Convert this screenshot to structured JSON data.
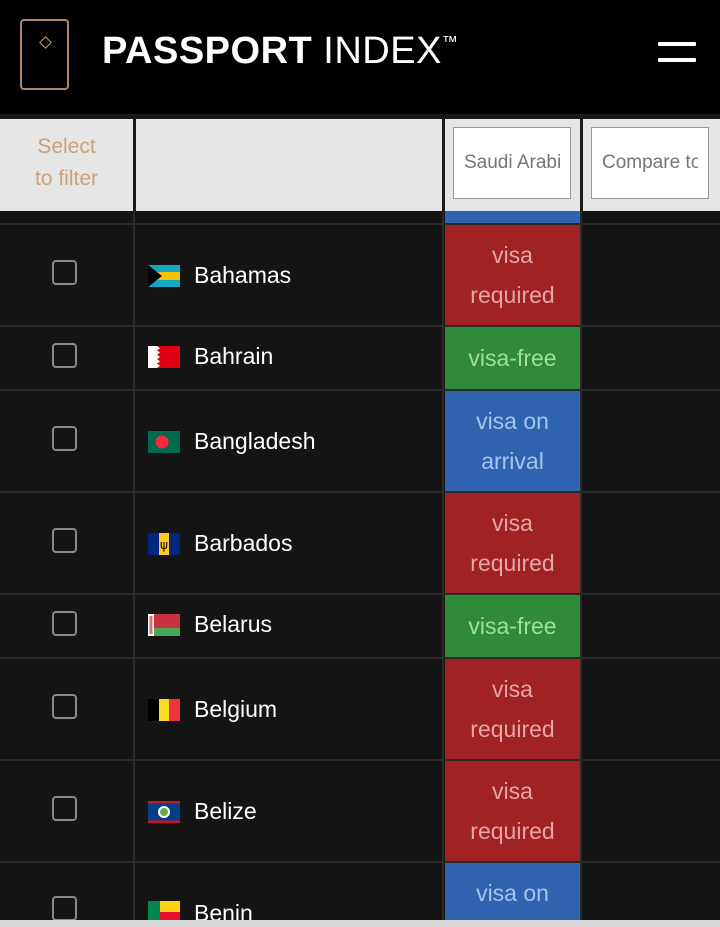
{
  "header": {
    "brand_bold": "PASSPORT",
    "brand_light": "INDEX",
    "trademark": "™"
  },
  "table_header": {
    "select_label": "Select to filter",
    "passport_placeholder": "Saudi Arabia",
    "compare_placeholder": "Compare to"
  },
  "colors": {
    "visa_required": "#a12222",
    "visa_free": "#2f8a3a",
    "visa_on_arrival": "#2f63b0",
    "accent": "#c9a27a"
  },
  "rows": [
    {
      "country": "Bahamas",
      "status": "visa required",
      "flag_icon": "bahamas-flag-icon"
    },
    {
      "country": "Bahrain",
      "status": "visa-free",
      "flag_icon": "bahrain-flag-icon"
    },
    {
      "country": "Bangladesh",
      "status": "visa on arrival",
      "flag_icon": "bangladesh-flag-icon"
    },
    {
      "country": "Barbados",
      "status": "visa required",
      "flag_icon": "barbados-flag-icon"
    },
    {
      "country": "Belarus",
      "status": "visa-free",
      "flag_icon": "belarus-flag-icon"
    },
    {
      "country": "Belgium",
      "status": "visa required",
      "flag_icon": "belgium-flag-icon"
    },
    {
      "country": "Belize",
      "status": "visa required",
      "flag_icon": "belize-flag-icon"
    },
    {
      "country": "Benin",
      "status": "visa on",
      "flag_icon": "benin-flag-icon"
    }
  ]
}
